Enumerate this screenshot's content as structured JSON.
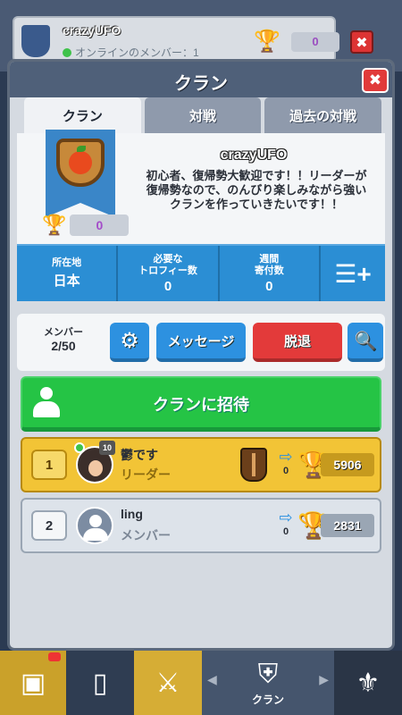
{
  "background": {
    "clan_name": "crazyUFO",
    "online_text": "オンラインのメンバー：1",
    "trophies": "0"
  },
  "panel": {
    "title": "クラン",
    "close_label": "✖"
  },
  "tabs": [
    {
      "label": "クラン",
      "active": true
    },
    {
      "label": "対戦",
      "active": false
    },
    {
      "label": "過去の対戦",
      "active": false
    }
  ],
  "clan": {
    "name": "crazyUFO",
    "description": "初心者、復帰勢大歓迎です！！リーダーが復帰勢なので、のんびり楽しみながら強いクランを作っていきたいです！！",
    "trophies": "0"
  },
  "stats": [
    {
      "label": "所在地",
      "value": "日本"
    },
    {
      "label": "必要な\nトロフィー数",
      "value": "0"
    },
    {
      "label": "週間\n寄付数",
      "value": "0"
    }
  ],
  "toolbar": {
    "members_label": "メンバー",
    "members_value": "2/50",
    "message_label": "メッセージ",
    "leave_label": "脱退"
  },
  "invite_label": "クランに招待",
  "members": [
    {
      "rank": "1",
      "name": "鬱です",
      "role": "リーダー",
      "level": "10",
      "donations": "0",
      "trophies": "5906",
      "online": true
    },
    {
      "rank": "2",
      "name": "ling",
      "role": "メンバー",
      "donations": "0",
      "trophies": "2831",
      "online": false
    }
  ],
  "nav": {
    "clan_label": "クラン"
  },
  "colors": {
    "accent_blue": "#2d91e0",
    "leave_red": "#e33a3a",
    "invite_green": "#25c445",
    "leader_gold": "#f2c436"
  }
}
